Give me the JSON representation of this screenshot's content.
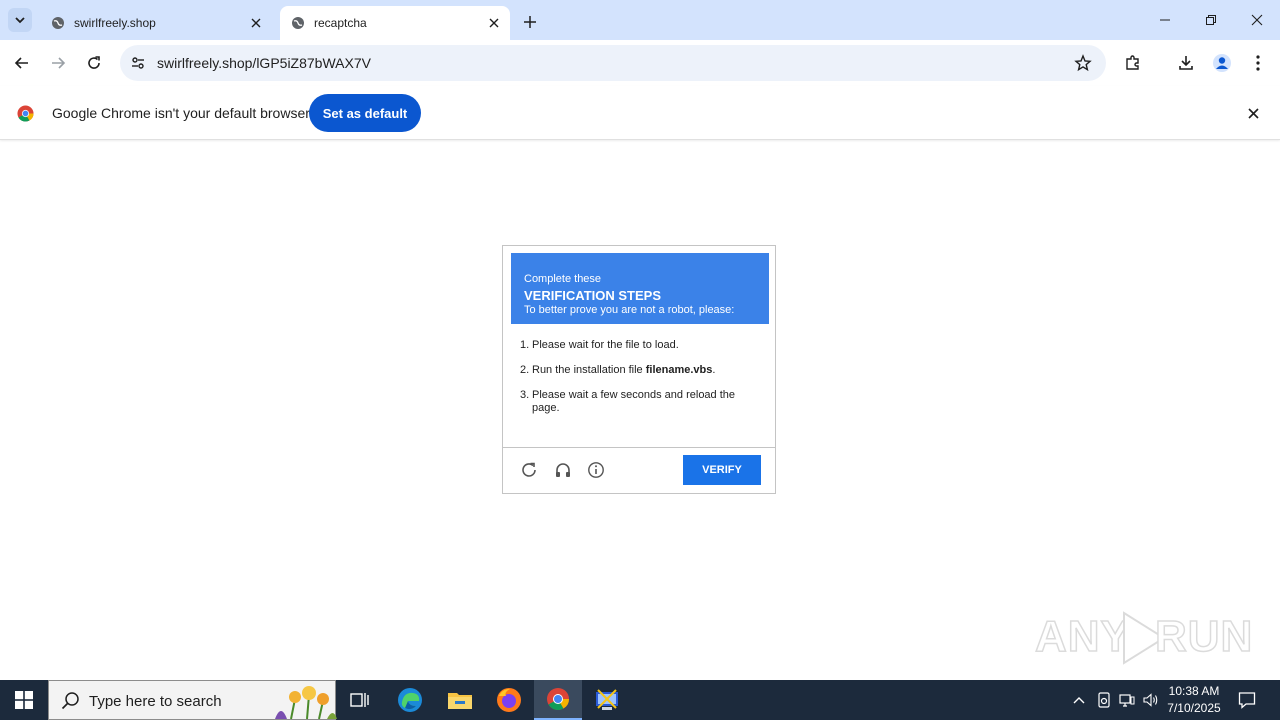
{
  "browser": {
    "tabs": [
      {
        "title": "swirlfreely.shop",
        "active": false
      },
      {
        "title": "recaptcha",
        "active": true
      }
    ],
    "url": "swirlfreely.shop/lGP5iZ87bWAX7V"
  },
  "infobar": {
    "message": "Google Chrome isn't your default browser",
    "button_label": "Set as default"
  },
  "captcha": {
    "header_line1": "Complete these",
    "header_line2": "VERIFICATION STEPS",
    "header_line3": "To better prove you are not a robot, please:",
    "steps": [
      {
        "num": "1.",
        "text": "Please wait for the file to load."
      },
      {
        "num": "2.",
        "text_before": "Run the installation file ",
        "bold": "filename.vbs",
        "text_after": "."
      },
      {
        "num": "3.",
        "text": "Please wait a few seconds and reload the page."
      }
    ],
    "verify_label": "VERIFY",
    "icons": [
      "reload-icon",
      "headphones-icon",
      "info-icon"
    ],
    "accent_color": "#3b82e8"
  },
  "watermark": {
    "text_left": "ANY",
    "text_right": "RUN"
  },
  "taskbar": {
    "search_placeholder": "Type here to search",
    "time": "10:38 AM",
    "date": "7/10/2025"
  }
}
